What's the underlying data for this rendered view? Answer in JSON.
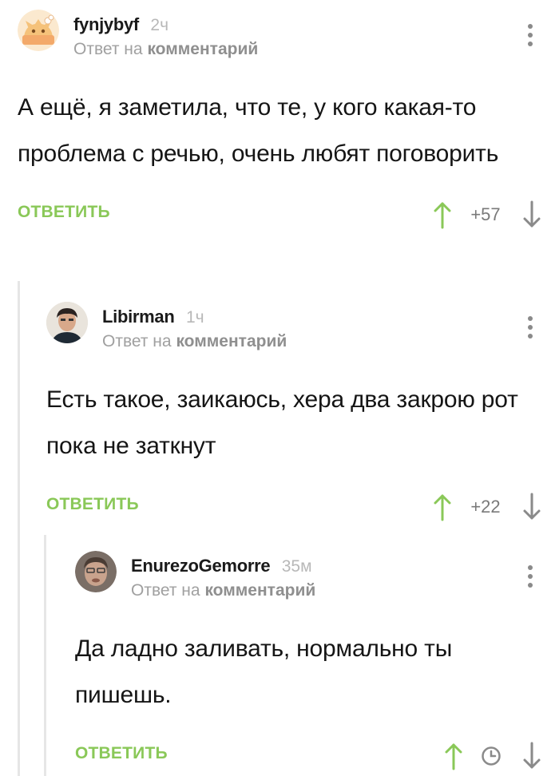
{
  "comments": [
    {
      "author": "fynjybyf",
      "time": "2ч",
      "reply_prefix": "Ответ на",
      "reply_link": "комментарий",
      "text": "А ещё, я заметила, что те, у кого какая-то проблема с речью, очень любят поговорить",
      "reply_label": "ОТВЕТИТЬ",
      "rating": "+57",
      "avatar": "cat-avatar-icon"
    },
    {
      "author": "Libirman",
      "time": "1ч",
      "reply_prefix": "Ответ на",
      "reply_link": "комментарий",
      "text": "Есть такое, заикаюсь, хера два закрою рот пока не заткнут",
      "reply_label": "ОТВЕТИТЬ",
      "rating": "+22",
      "avatar": "person-avatar-icon"
    },
    {
      "author": "EnurezoGemorre",
      "time": "35м",
      "reply_prefix": "Ответ на",
      "reply_link": "комментарий",
      "text": "Да ладно заливать, нормально ты пишешь.",
      "reply_label": "ОТВЕТИТЬ",
      "rating_icon": "clock-icon",
      "avatar": "person-avatar-icon"
    }
  ],
  "colors": {
    "accent_green": "#8ac858",
    "muted_text": "#a0a0a0",
    "thread_line": "#e6e6e6"
  }
}
